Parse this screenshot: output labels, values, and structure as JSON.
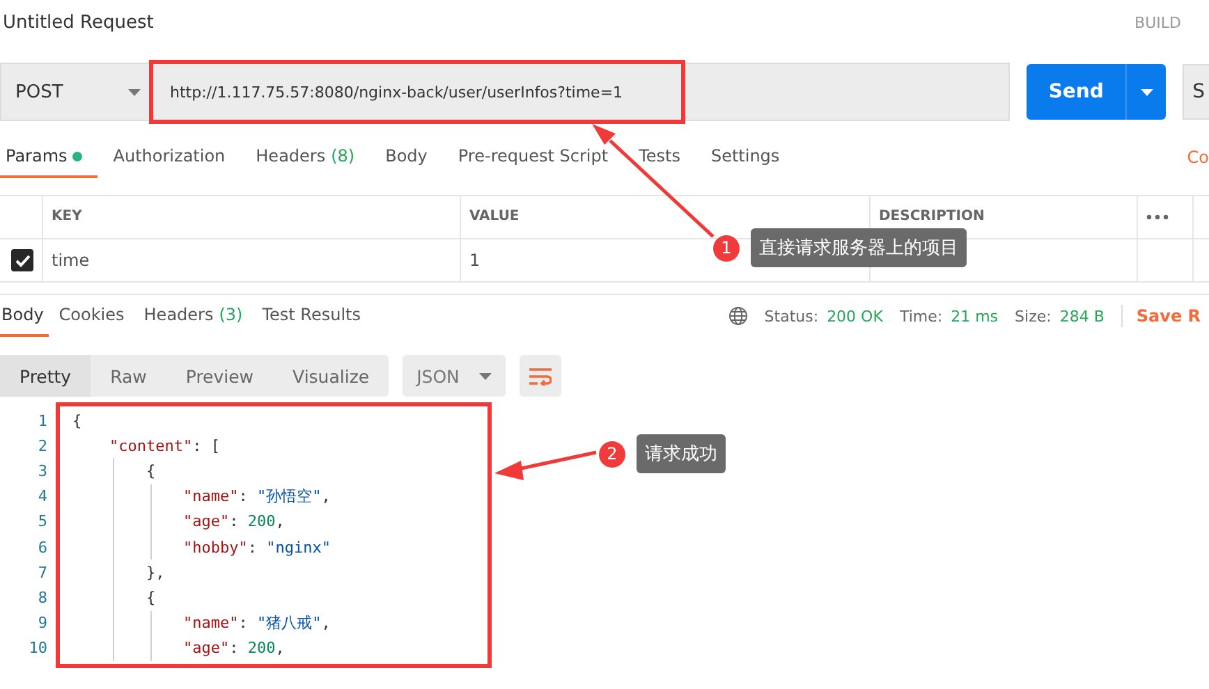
{
  "title": "Untitled Request",
  "build_label": "BUILD",
  "request": {
    "method": "POST",
    "url": "http://1.117.75.57:8080/nginx-back/user/userInfos?time=1",
    "send": "Send",
    "save_cut": "S"
  },
  "request_tabs": [
    {
      "label": "Params",
      "dot": true,
      "selected": true
    },
    {
      "label": "Authorization",
      "dot": false,
      "selected": false
    },
    {
      "label": "Headers",
      "count": "(8)",
      "dot": false,
      "selected": false
    },
    {
      "label": "Body",
      "dot": false,
      "selected": false
    },
    {
      "label": "Pre-request Script",
      "dot": false,
      "selected": false
    },
    {
      "label": "Tests",
      "dot": false,
      "selected": false
    },
    {
      "label": "Settings",
      "dot": false,
      "selected": false
    }
  ],
  "cookies_cut": "Co",
  "params": {
    "columns": [
      "KEY",
      "VALUE",
      "DESCRIPTION"
    ],
    "rows": [
      {
        "checked": true,
        "key": "time",
        "value": "1"
      }
    ]
  },
  "response_tabs": [
    {
      "label": "Body",
      "selected": true
    },
    {
      "label": "Cookies",
      "selected": false
    },
    {
      "label": "Headers",
      "count": "(3)",
      "selected": false
    },
    {
      "label": "Test Results",
      "selected": false
    }
  ],
  "status": [
    {
      "label": "Status:",
      "value": "200 OK"
    },
    {
      "label": "Time:",
      "value": "21 ms"
    },
    {
      "label": "Size:",
      "value": "284 B"
    }
  ],
  "save_response_cut": "Save R",
  "view_tabs": [
    {
      "label": "Pretty",
      "selected": true
    },
    {
      "label": "Raw",
      "selected": false
    },
    {
      "label": "Preview",
      "selected": false
    },
    {
      "label": "Visualize",
      "selected": false
    }
  ],
  "format": "JSON",
  "code_lines": [
    {
      "number": "1",
      "tokens": [
        {
          "kind": "punct",
          "text": "{"
        }
      ],
      "children": [
        {
          "number": "2",
          "tokens": [
            {
              "kind": "key",
              "text": "\"content\""
            },
            {
              "kind": "punct",
              "text": ": ["
            }
          ],
          "children": [
            {
              "number": "3",
              "tokens": [
                {
                  "kind": "punct",
                  "text": "{"
                }
              ],
              "children": [
                {
                  "number": "4",
                  "tokens": [
                    {
                      "kind": "key",
                      "text": "\"name\""
                    },
                    {
                      "kind": "punct",
                      "text": ": "
                    },
                    {
                      "kind": "string",
                      "text": "\"孙悟空\""
                    },
                    {
                      "kind": "punct",
                      "text": ","
                    }
                  ]
                },
                {
                  "number": "5",
                  "tokens": [
                    {
                      "kind": "key",
                      "text": "\"age\""
                    },
                    {
                      "kind": "punct",
                      "text": ": "
                    },
                    {
                      "kind": "number",
                      "text": "200"
                    },
                    {
                      "kind": "punct",
                      "text": ","
                    }
                  ]
                },
                {
                  "number": "6",
                  "tokens": [
                    {
                      "kind": "key",
                      "text": "\"hobby\""
                    },
                    {
                      "kind": "punct",
                      "text": ": "
                    },
                    {
                      "kind": "string",
                      "text": "\"nginx\""
                    }
                  ]
                }
              ]
            },
            {
              "number": "7",
              "tokens": [
                {
                  "kind": "punct",
                  "text": "},"
                }
              ]
            },
            {
              "number": "8",
              "tokens": [
                {
                  "kind": "punct",
                  "text": "{"
                }
              ],
              "children": [
                {
                  "number": "9",
                  "tokens": [
                    {
                      "kind": "key",
                      "text": "\"name\""
                    },
                    {
                      "kind": "punct",
                      "text": ": "
                    },
                    {
                      "kind": "string",
                      "text": "\"猪八戒\""
                    },
                    {
                      "kind": "punct",
                      "text": ","
                    }
                  ]
                },
                {
                  "number": "10",
                  "tokens": [
                    {
                      "kind": "key",
                      "text": "\"age\""
                    },
                    {
                      "kind": "punct",
                      "text": ": "
                    },
                    {
                      "kind": "number",
                      "text": "200"
                    },
                    {
                      "kind": "punct",
                      "text": ","
                    }
                  ]
                }
              ]
            }
          ]
        }
      ]
    }
  ],
  "callouts": [
    {
      "number": "1",
      "text": "直接请求服务器上的项目"
    },
    {
      "number": "2",
      "text": "请求成功"
    }
  ]
}
